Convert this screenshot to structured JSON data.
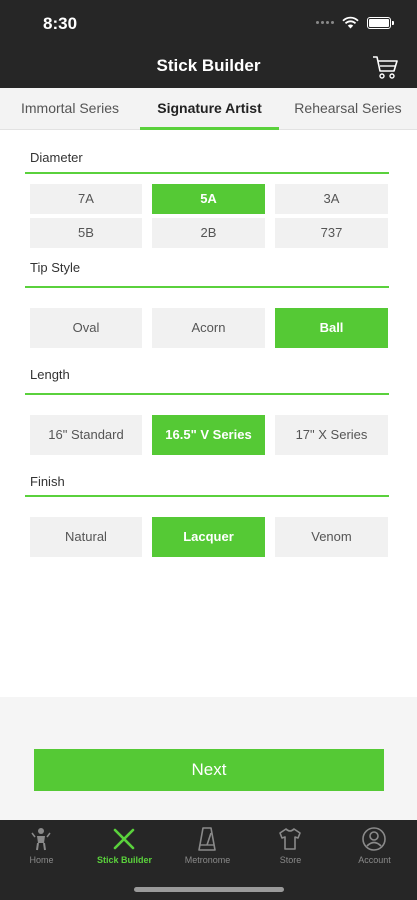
{
  "status_bar": {
    "time": "8:30"
  },
  "header": {
    "title": "Stick Builder"
  },
  "tabs": [
    {
      "label": "Immortal Series",
      "active": false
    },
    {
      "label": "Signature Artist",
      "active": true
    },
    {
      "label": "Rehearsal Series",
      "active": false
    }
  ],
  "sections": {
    "diameter": {
      "title": "Diameter",
      "options": [
        "7A",
        "5A",
        "3A",
        "5B",
        "2B",
        "737"
      ],
      "selected": "5A"
    },
    "tip_style": {
      "title": "Tip Style",
      "options": [
        "Oval",
        "Acorn",
        "Ball"
      ],
      "selected": "Ball"
    },
    "length": {
      "title": "Length",
      "options": [
        "16\" Standard",
        "16.5\" V Series",
        "17\" X Series"
      ],
      "selected": "16.5\" V Series"
    },
    "finish": {
      "title": "Finish",
      "options": [
        "Natural",
        "Lacquer",
        "Venom"
      ],
      "selected": "Lacquer"
    }
  },
  "next_button": {
    "label": "Next"
  },
  "bottom_nav": [
    {
      "label": "Home",
      "icon": "drummer-icon",
      "active": false
    },
    {
      "label": "Stick Builder",
      "icon": "crossed-sticks-icon",
      "active": true
    },
    {
      "label": "Metronome",
      "icon": "metronome-icon",
      "active": false
    },
    {
      "label": "Store",
      "icon": "shirt-icon",
      "active": false
    },
    {
      "label": "Account",
      "icon": "user-icon",
      "active": false
    }
  ],
  "colors": {
    "accent": "#55c935",
    "header_bg": "#262626",
    "option_bg": "#f1f1f1"
  }
}
